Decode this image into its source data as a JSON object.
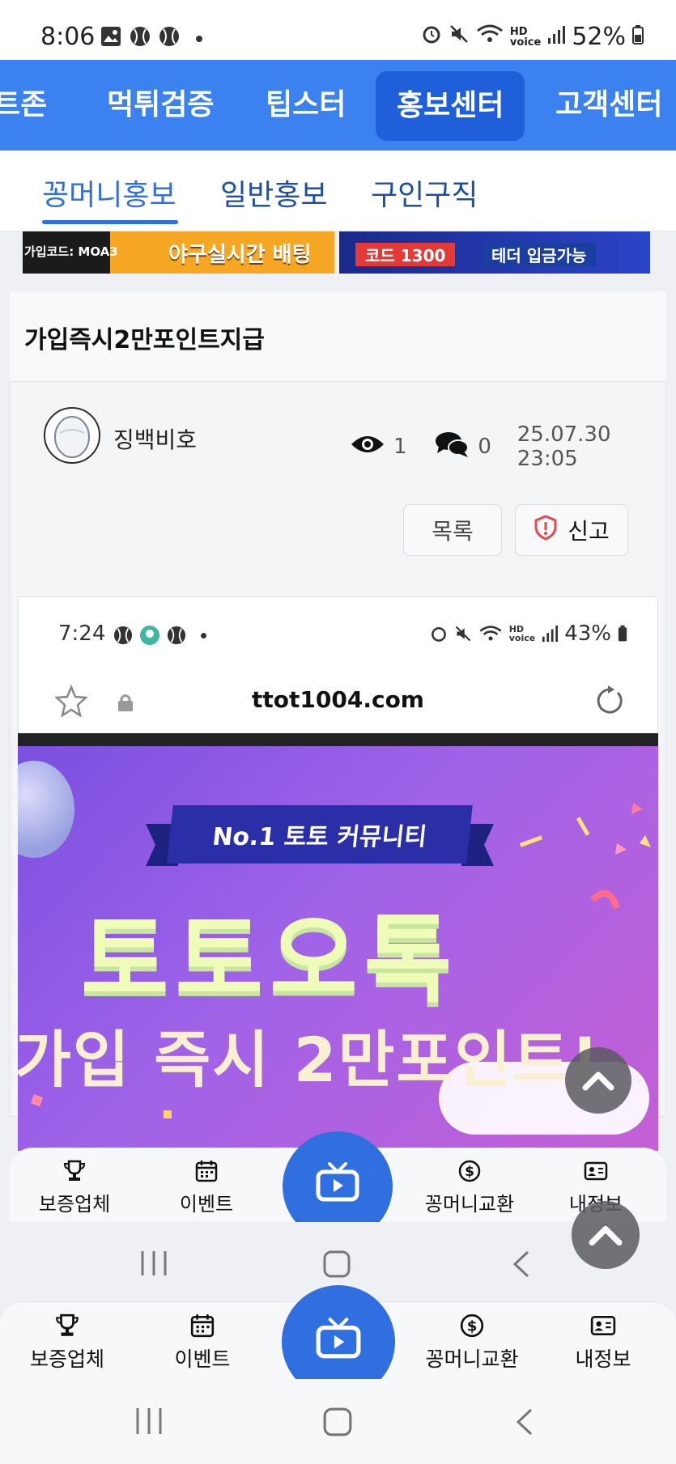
{
  "status_bar": {
    "time": "8:06",
    "battery": "52%"
  },
  "top_nav": {
    "items": [
      "트존",
      "먹튀검증",
      "팁스터",
      "홍보센터",
      "고객센터"
    ],
    "active": "홍보센터"
  },
  "sub_nav": {
    "items": [
      "꽁머니홍보",
      "일반홍보",
      "구인구직"
    ],
    "active": "꽁머니홍보"
  },
  "banner": {
    "left_code": "가입코드: MOA3",
    "left_text": "야구실시간 배팅",
    "right_code": "코드 1300",
    "right_text": "테더 입금가능"
  },
  "post": {
    "title": "가입즉시2만포인트지급",
    "author": "징백비호",
    "views": "1",
    "comments": "0",
    "datetime": "25.07.30 23:05",
    "list_button": "목록",
    "report_button": "신고"
  },
  "embedded": {
    "time": "7:24",
    "battery": "43%",
    "url": "ttot1004.com",
    "ribbon": "No.1 토토 커뮤니티",
    "title": "토토오톡",
    "subtitle": "가입 즉시 2만포인트!"
  },
  "inner_nav": {
    "items": [
      "보증업체",
      "이벤트",
      "꽁머니교환",
      "내정보"
    ]
  },
  "outer_nav": {
    "items": [
      "보증업체",
      "이벤트",
      "꽁머니교환",
      "내정보"
    ]
  },
  "colors": {
    "primary": "#3b82f0",
    "primary_dark": "#1f5fd9",
    "report_red": "#e5484d"
  }
}
